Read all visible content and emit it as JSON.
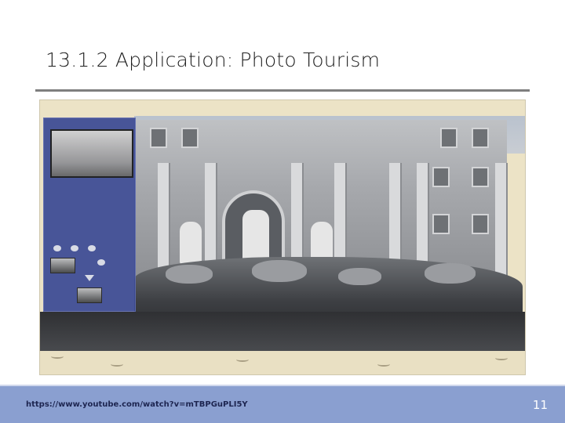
{
  "slide": {
    "title": "13.1.2  Application: Photo Tourism",
    "footer_link": "https://www.youtube.com/watch?v=mTBPGuPLI5Y",
    "page_number": "11"
  },
  "photo": {
    "description_colors": {
      "panel": "#3b4a95",
      "frame": "#ece3c6",
      "footer": "#8a9fd0"
    }
  }
}
